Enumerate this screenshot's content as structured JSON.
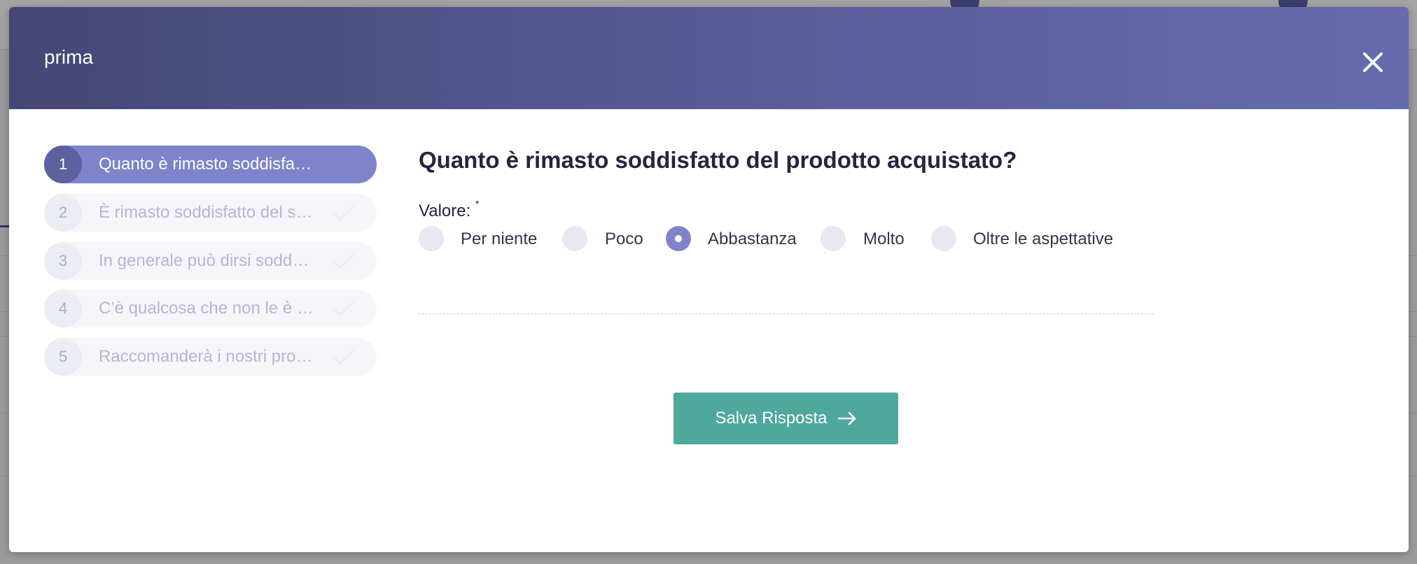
{
  "modal": {
    "title": "prima",
    "close_icon": "close-icon"
  },
  "steps": [
    {
      "number": "1",
      "label": "Quanto è rimasto soddisfa…",
      "active": true
    },
    {
      "number": "2",
      "label": "È rimasto soddisfatto del s…",
      "active": false
    },
    {
      "number": "3",
      "label": "In generale può dirsi sodd…",
      "active": false
    },
    {
      "number": "4",
      "label": "C’è qualcosa che non le è …",
      "active": false
    },
    {
      "number": "5",
      "label": "Raccomanderà i nostri pro…",
      "active": false
    }
  ],
  "question": {
    "title": "Quanto è rimasto soddisfatto del prodotto acquistato?",
    "field_label": "Valore:",
    "required_mark": "*",
    "options": [
      "Per niente",
      "Poco",
      "Abbastanza",
      "Molto",
      "Oltre le aspettative"
    ],
    "selected": "Abbastanza"
  },
  "actions": {
    "save_label": "Salva Risposta",
    "save_icon": "arrow-right-icon"
  },
  "colors": {
    "header_start": "#464776",
    "header_end": "#666bad",
    "accent": "#7f83c9",
    "save_button": "#4ea89c"
  }
}
